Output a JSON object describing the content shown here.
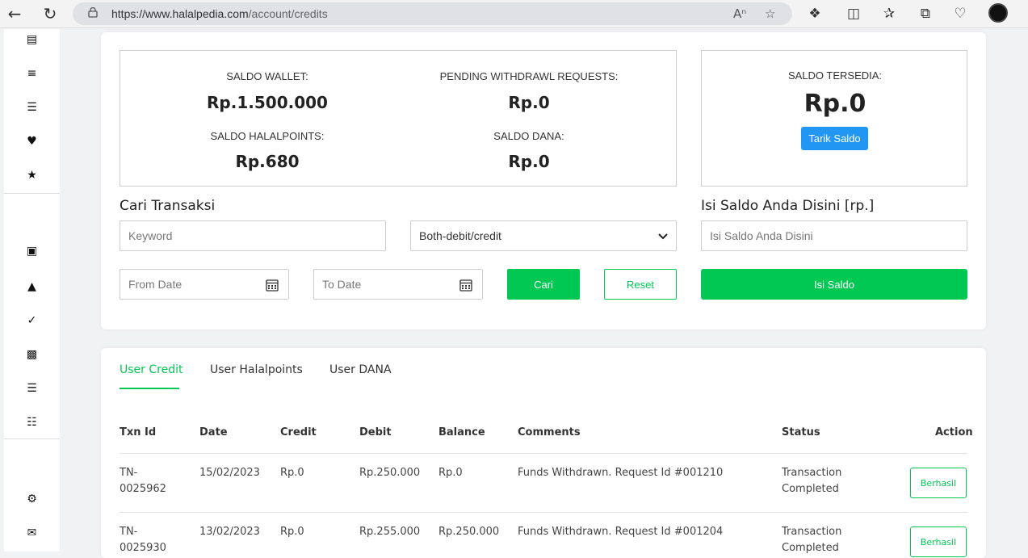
{
  "browser": {
    "url_domain": "https://www.halalpedia.com",
    "url_path": "/account/credits"
  },
  "summary": {
    "saldo_wallet_label": "SALDO WALLET:",
    "saldo_wallet_value": "Rp.1.500.000",
    "pending_label": "PENDING WITHDRAWL REQUESTS:",
    "pending_value": "Rp.0",
    "halalpoints_label": "SALDO HALALPOINTS:",
    "halalpoints_value": "Rp.680",
    "dana_label": "SALDO DANA:",
    "dana_value": "Rp.0",
    "tersedia_label": "SALDO TERSEDIA:",
    "tersedia_value": "Rp.0",
    "tarik_button": "Tarik Saldo"
  },
  "search": {
    "title": "Cari Transaksi",
    "keyword_placeholder": "Keyword",
    "type_selected": "Both-debit/credit",
    "from_placeholder": "From Date",
    "to_placeholder": "To Date",
    "search_button": "Cari",
    "reset_button": "Reset"
  },
  "topup": {
    "title": "Isi Saldo Anda Disini [rp.]",
    "placeholder": "Isi Saldo Anda Disini",
    "button": "Isi Saldo"
  },
  "tabs": [
    {
      "label": "User Credit",
      "active": true
    },
    {
      "label": "User Halalpoints",
      "active": false
    },
    {
      "label": "User DANA",
      "active": false
    }
  ],
  "table": {
    "headers": {
      "txn": "Txn Id",
      "date": "Date",
      "credit": "Credit",
      "debit": "Debit",
      "balance": "Balance",
      "comments": "Comments",
      "status": "Status",
      "action": "Action"
    },
    "rows": [
      {
        "txn1": "TN-",
        "txn2": "0025962",
        "date": "15/02/2023",
        "credit": "Rp.0",
        "debit": "Rp.250.000",
        "balance": "Rp.0",
        "comments": "Funds Withdrawn. Request Id #001210",
        "status1": "Transaction",
        "status2": "Completed",
        "action": "Berhasil"
      },
      {
        "txn1": "TN-",
        "txn2": "0025930",
        "date": "13/02/2023",
        "credit": "Rp.0",
        "debit": "Rp.255.000",
        "balance": "Rp.250.000",
        "comments": "Funds Withdrawn. Request Id #001204",
        "status1": "Transaction",
        "status2": "Completed",
        "action": "Berhasil"
      }
    ]
  },
  "colors": {
    "accent_green": "#00c853",
    "blue_button": "#2196f3"
  }
}
